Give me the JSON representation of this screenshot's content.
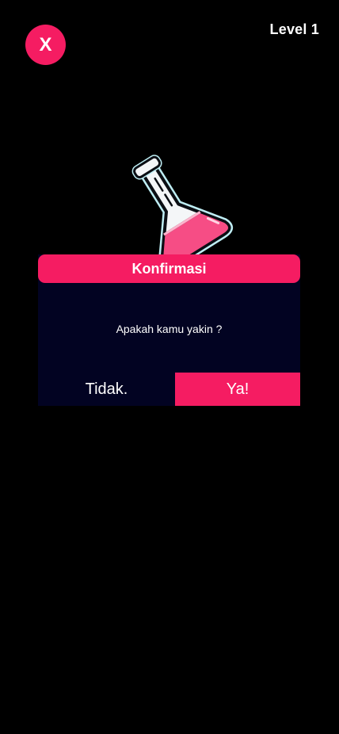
{
  "header": {
    "close_label": "X",
    "level_label": "Level 1"
  },
  "illustration": {
    "icon": "chemistry-flask-icon",
    "liquid_color": "#f64d85"
  },
  "dialog": {
    "title": "Konfirmasi",
    "message": "Apakah kamu yakin ?",
    "cancel_label": "Tidak.",
    "confirm_label": "Ya!"
  },
  "colors": {
    "accent": "#f51c62",
    "dialog_background": "#020322",
    "page_background": "#000000"
  }
}
